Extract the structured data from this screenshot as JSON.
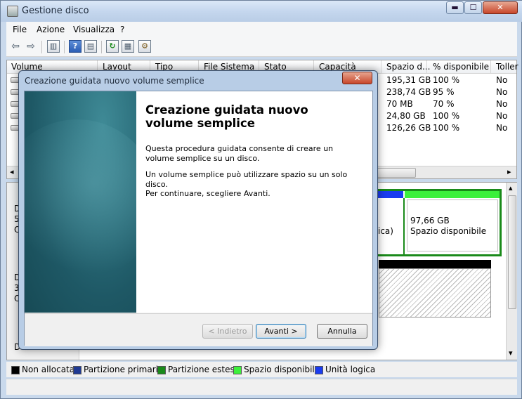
{
  "window": {
    "title": "Gestione disco",
    "controls": {
      "minimize": "▬",
      "maximize": "☐",
      "close": "✕"
    }
  },
  "menu": [
    "File",
    "Azione",
    "Visualizza",
    "?"
  ],
  "toolbar": {
    "icons": [
      "back-arrow-icon",
      "forward-arrow-icon",
      "console-tree-icon",
      "help-icon",
      "action-pane-icon",
      "refresh-icon",
      "properties-icon",
      "settings-icon"
    ],
    "glyphs": {
      "back": "⇦",
      "forward": "⇨",
      "tree": "▥",
      "help": "?",
      "pane": "▤",
      "refresh": "↻",
      "props": "▦",
      "settings": "⚙"
    }
  },
  "volume_list": {
    "columns": [
      "Volume",
      "Layout",
      "Tipo",
      "File Sistema",
      "Stato",
      "Capacità",
      "Spazio d...",
      "% disponibile",
      "Toller"
    ],
    "rows": [
      {
        "spazio": "195,31 GB",
        "percent": "100 %",
        "toller": "No"
      },
      {
        "spazio": "238,74 GB",
        "percent": "95 %",
        "toller": "No"
      },
      {
        "spazio": "70 MB",
        "percent": "70 %",
        "toller": "No"
      },
      {
        "spazio": "24,80 GB",
        "percent": "100 %",
        "toller": "No"
      },
      {
        "spazio": "126,26 GB",
        "percent": "100 %",
        "toller": "No"
      }
    ],
    "scroll_left": "◂",
    "scroll_right": "▸"
  },
  "disk_map": {
    "left_letters": [
      "D",
      "5",
      "O",
      "D",
      "3",
      "O",
      "D"
    ],
    "partition_fragment": "ica)",
    "free_size": "97,66 GB",
    "free_label": "Spazio disponibile",
    "scroll_up": "▴",
    "scroll_down": "▾"
  },
  "legend": [
    {
      "label": "Non allocata",
      "color": "#000000"
    },
    {
      "label": "Partizione primaria",
      "color": "#1f3a93"
    },
    {
      "label": "Partizione estesa",
      "color": "#1a8a1a"
    },
    {
      "label": "Spazio disponibile",
      "color": "#3cf03c"
    },
    {
      "label": "Unità logica",
      "color": "#1a3cf0"
    }
  ],
  "wizard": {
    "title": "Creazione guidata nuovo volume semplice",
    "close": "✕",
    "heading": "Creazione guidata nuovo volume semplice",
    "paragraphs": [
      "Questa procedura guidata consente di creare un volume semplice su un disco.",
      "Un volume semplice può utilizzare spazio su un solo disco.",
      "Per continuare, scegliere Avanti."
    ],
    "buttons": {
      "back": "< Indietro",
      "next": "Avanti >",
      "cancel": "Annulla"
    }
  }
}
